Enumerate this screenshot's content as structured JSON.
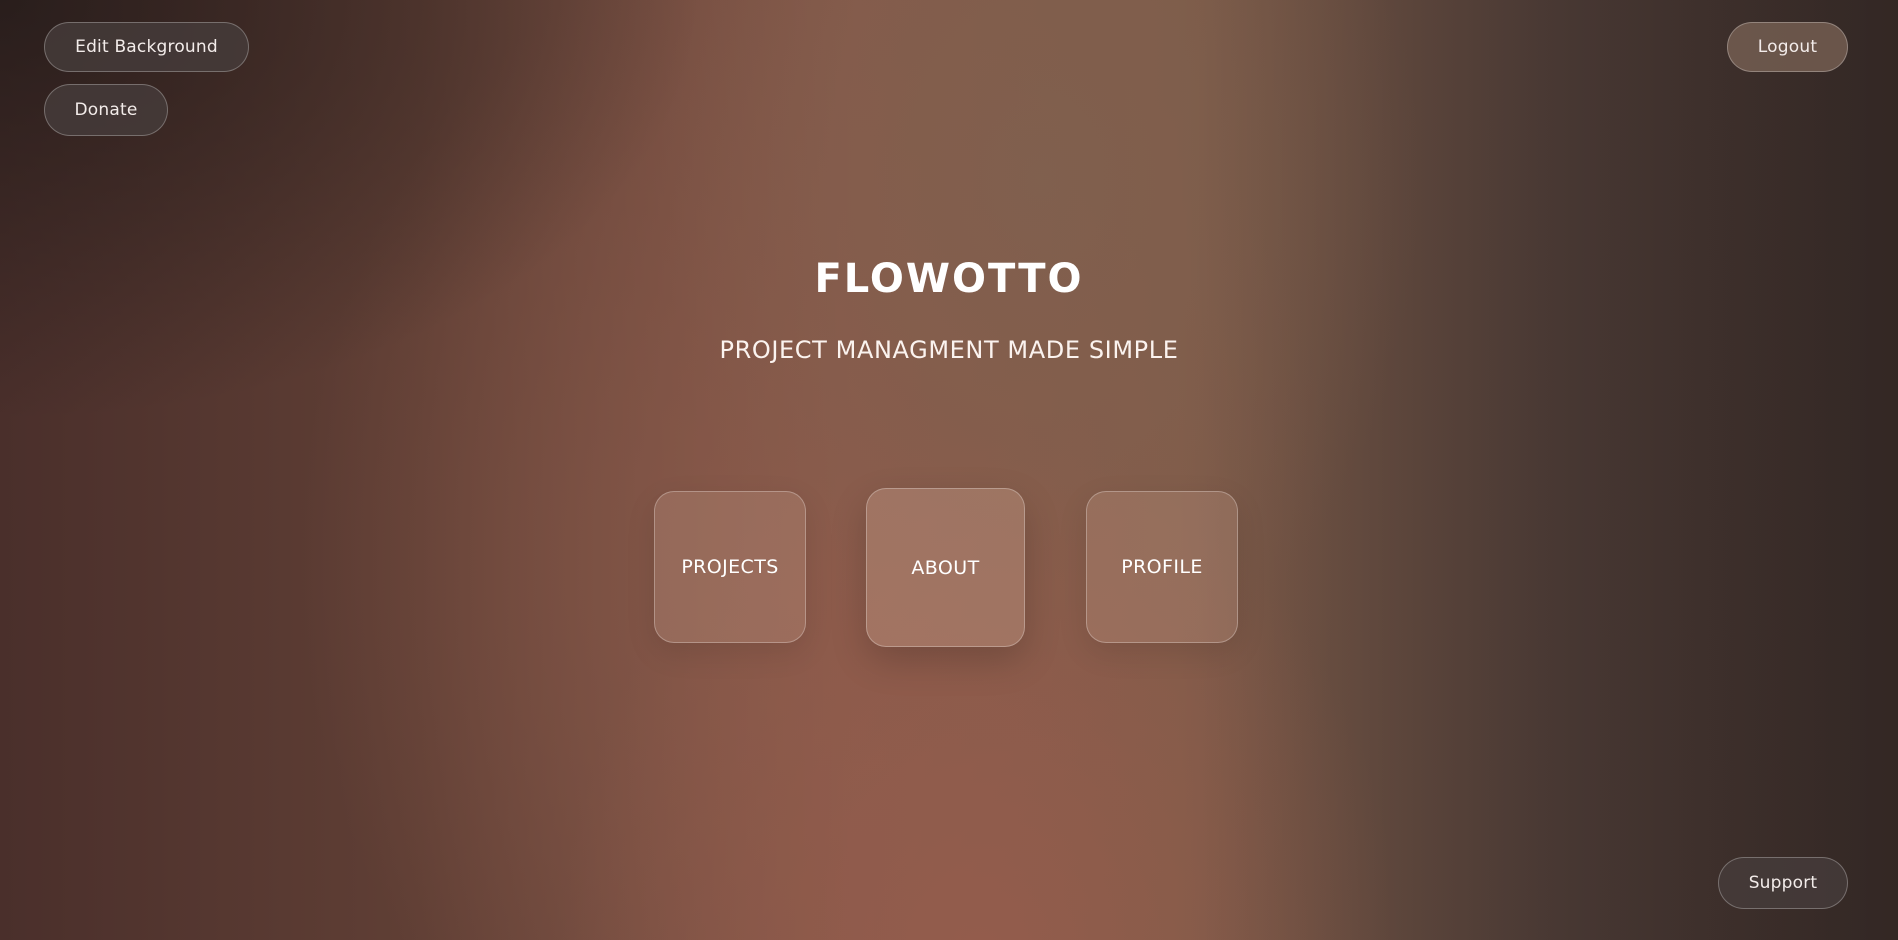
{
  "top_left": {
    "edit_background_label": "Edit Background",
    "donate_label": "Donate"
  },
  "top_right": {
    "logout_label": "Logout"
  },
  "hero": {
    "title": "FLOWOTTO",
    "subtitle": "PROJECT MANAGMENT MADE SIMPLE"
  },
  "nav_tiles": [
    {
      "label": "PROJECTS"
    },
    {
      "label": "ABOUT"
    },
    {
      "label": "PROFILE"
    }
  ],
  "bottom_right": {
    "support_label": "Support"
  },
  "colors": {
    "background_mid": "#85594a",
    "background_dark": "#3c2f2b",
    "text": "#ffffff"
  }
}
